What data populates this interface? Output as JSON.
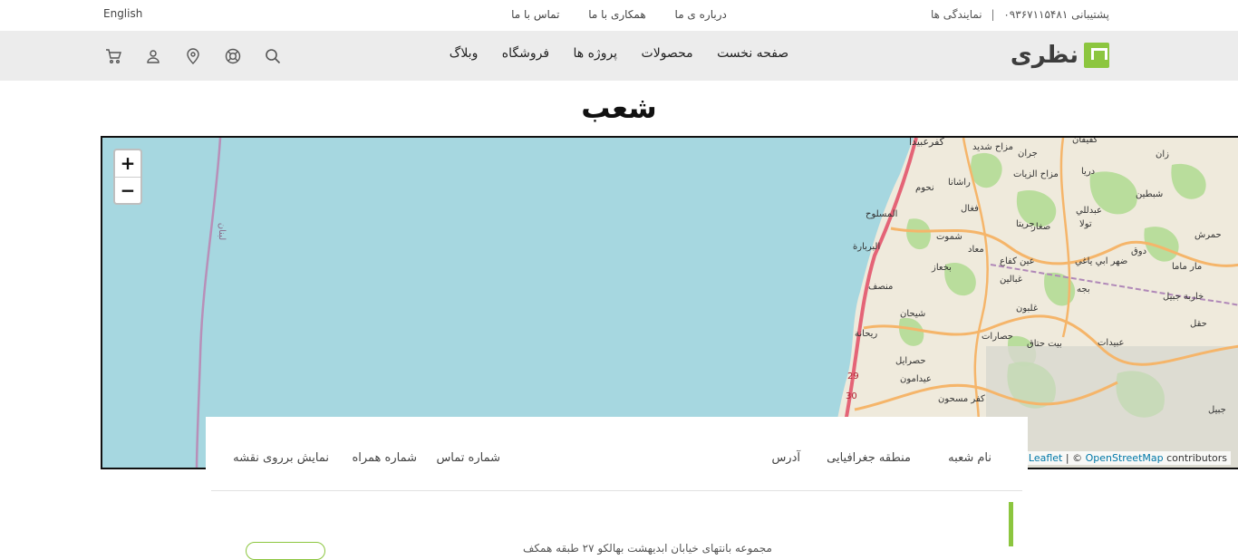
{
  "topbar": {
    "language": "English",
    "links": [
      "درباره ی ما",
      "همکاری با ما",
      "تماس با ما"
    ],
    "support_label": "پشتیبانی",
    "support_phone": "۰۹۳۶۷۱۱۵۴۸۱",
    "separator": "|",
    "agencies_label": "نمایندگی ها"
  },
  "header": {
    "logo_text": "نظری",
    "nav": [
      "صفحه نخست",
      "محصولات",
      "پروژه ها",
      "فروشگاه",
      "وبلاگ"
    ],
    "icons": [
      "cart-icon",
      "user-icon",
      "location-icon",
      "support-icon",
      "search-icon"
    ]
  },
  "page": {
    "title": "شعب"
  },
  "map": {
    "zoom_in": "+",
    "zoom_out": "−",
    "attribution_leaflet": "Leaflet",
    "attribution_sep": " | © ",
    "attribution_osm": "OpenStreetMap",
    "attribution_suffix": " contributors",
    "places": [
      "كفرعبيدا",
      "مزاح شديد",
      "جران",
      "كفيفان",
      "زان",
      "دريا",
      "مزاح الزيات",
      "راشانا",
      "نحوم",
      "المسلوح",
      "عبدللي",
      "شبطين",
      "فغال",
      "جريتا",
      "تولا",
      "صغار",
      "البربارة",
      "شموت",
      "معاد",
      "دوق",
      "حمرش",
      "عين كفاع",
      "ضهر ابي ياغي",
      "مار ماما",
      "بخعاز",
      "غبالين",
      "منصف",
      "بجه",
      "خاربة جبيل",
      "شيحان",
      "غلبون",
      "حقل",
      "ريحانة",
      "حصارات",
      "بيت حتاق",
      "عبيدات",
      "حصرايل",
      "عيدامون",
      "كفر مسحون",
      "جبيل",
      "لبنان"
    ],
    "road_numbers": [
      "29",
      "30"
    ]
  },
  "table": {
    "headers": [
      "نام شعبه",
      "منطقه جغرافیایی",
      "آدرس",
      "شماره تماس",
      "شماره همراه",
      "نمایش برروی نقشه"
    ],
    "first_row_address": "مجموعه بانتهای خیابان ابدیهشت بهالکو ۲۷ طبقه همکف"
  },
  "colors": {
    "brand_green": "#8cc63f",
    "sea": "#a6d7e0",
    "header_bg": "#ececec"
  }
}
